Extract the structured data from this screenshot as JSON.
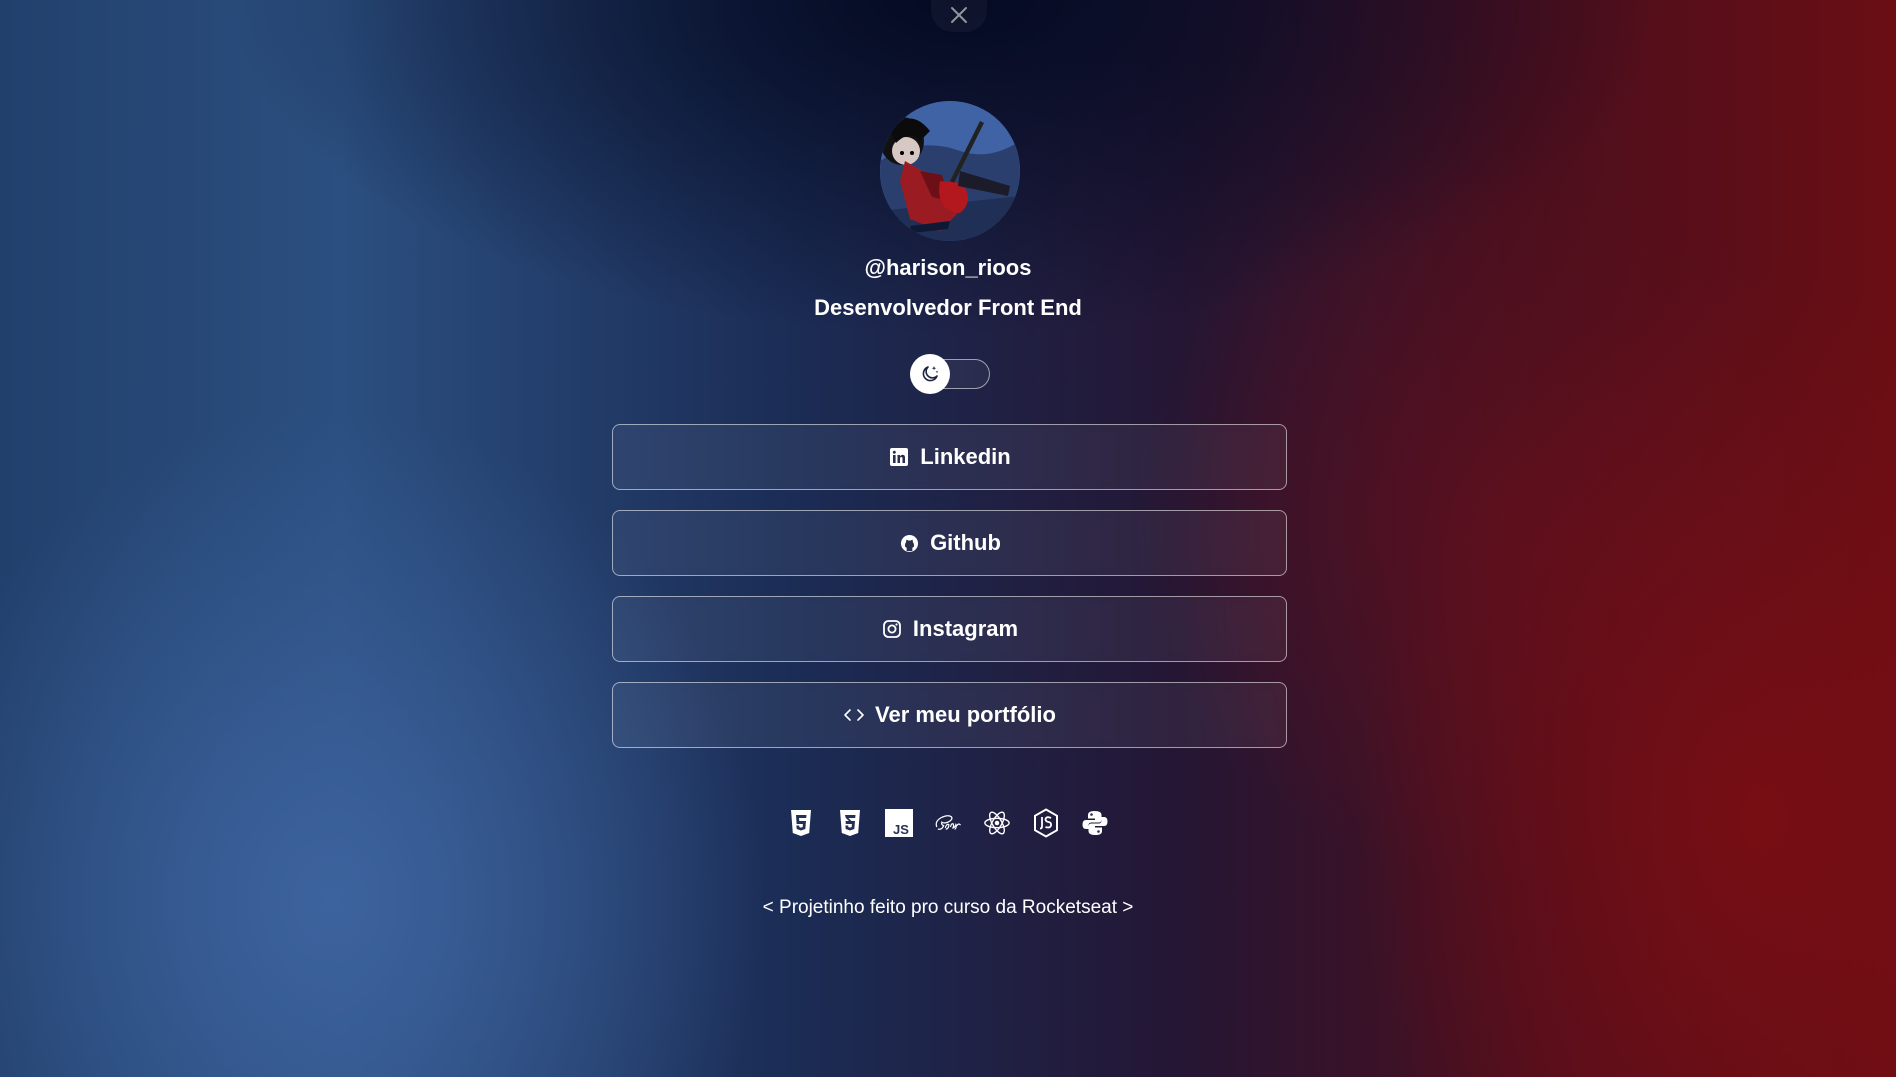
{
  "profile": {
    "username": "@harison_rioos",
    "role": "Desenvolvedor Front End"
  },
  "links": [
    {
      "label": "Linkedin",
      "icon": "linkedin-icon"
    },
    {
      "label": "Github",
      "icon": "github-icon"
    },
    {
      "label": "Instagram",
      "icon": "instagram-icon"
    },
    {
      "label": "Ver meu portfólio",
      "icon": "code-icon"
    }
  ],
  "tech_icons": [
    "html5-icon",
    "css3-icon",
    "javascript-icon",
    "sass-icon",
    "react-icon",
    "nodejs-icon",
    "python-icon"
  ],
  "footer": {
    "text": "< Projetinho feito pro curso da Rocketseat >"
  },
  "theme": {
    "mode": "dark",
    "toggle_icon": "moon-stars-icon"
  },
  "colors": {
    "text": "#ffffff",
    "left_glow": "#2f5283",
    "right_glow": "#7a0e14",
    "top_dark": "#050b22"
  }
}
